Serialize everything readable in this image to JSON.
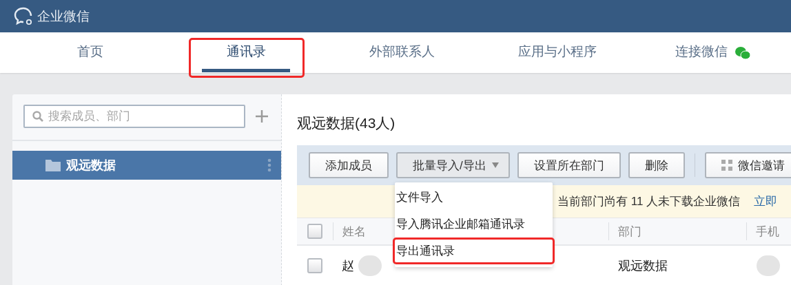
{
  "app": {
    "title": "企业微信"
  },
  "nav_tabs": [
    {
      "label": "首页",
      "selected": false,
      "highlighted": false,
      "kind": "plain"
    },
    {
      "label": "通讯录",
      "selected": true,
      "highlighted": true,
      "kind": "plain"
    },
    {
      "label": "外部联系人",
      "selected": false,
      "highlighted": false,
      "kind": "plain"
    },
    {
      "label": "应用与小程序",
      "selected": false,
      "highlighted": false,
      "kind": "plain"
    },
    {
      "label": "连接微信",
      "selected": false,
      "highlighted": false,
      "kind": "wechat"
    }
  ],
  "sidebar": {
    "search": {
      "placeholder": "搜索成员、部门"
    },
    "departments": [
      {
        "label": "观远数据",
        "selected": true
      }
    ]
  },
  "department": {
    "title": "观远数据(43人)"
  },
  "toolbar": [
    {
      "label": "添加成员",
      "kind": "plain"
    },
    {
      "label": "批量导入/导出",
      "kind": "dropdown"
    },
    {
      "label": "设置所在部门",
      "kind": "plain"
    },
    {
      "label": "删除",
      "kind": "plain"
    },
    {
      "label": "微信邀请",
      "kind": "qr"
    }
  ],
  "dropdown_menu": [
    {
      "label": "文件导入",
      "highlighted": false
    },
    {
      "label": "导入腾讯企业邮箱通讯录",
      "highlighted": false
    },
    {
      "label": "导出通讯录",
      "highlighted": true
    }
  ],
  "notice": {
    "text": "当前部门尚有 11 人未下载企业微信",
    "link": "立即"
  },
  "table": {
    "columns": [
      "姓名",
      "部门",
      "手机"
    ],
    "header_checked": false,
    "rows": [
      {
        "checked": false,
        "name": "赵",
        "department": "观远数据"
      }
    ]
  }
}
